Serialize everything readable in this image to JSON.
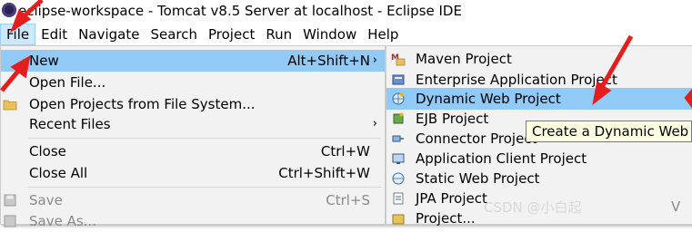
{
  "window": {
    "title": "eclipse-workspace - Tomcat v8.5 Server at localhost - Eclipse IDE"
  },
  "menubar": [
    "File",
    "Edit",
    "Navigate",
    "Search",
    "Project",
    "Run",
    "Window",
    "Help"
  ],
  "file_menu": {
    "new": {
      "label": "New",
      "shortcut": "Alt+Shift+N"
    },
    "open_file": "Open File...",
    "open_projects": "Open Projects from File System...",
    "recent_files": "Recent Files",
    "close": {
      "label": "Close",
      "shortcut": "Ctrl+W"
    },
    "close_all": {
      "label": "Close All",
      "shortcut": "Ctrl+Shift+W"
    },
    "save": {
      "label": "Save",
      "shortcut": "Ctrl+S"
    },
    "save_as": "Save As..."
  },
  "new_submenu": [
    {
      "label": "Maven Project",
      "icon": "maven-project-icon"
    },
    {
      "label": "Enterprise Application Project",
      "icon": "enterprise-app-icon"
    },
    {
      "label": "Dynamic Web Project",
      "icon": "dynamic-web-project-icon"
    },
    {
      "label": "EJB Project",
      "icon": "ejb-project-icon"
    },
    {
      "label": "Connector Project",
      "icon": "connector-project-icon"
    },
    {
      "label": "Application Client Project",
      "icon": "app-client-project-icon"
    },
    {
      "label": "Static Web Project",
      "icon": "static-web-project-icon"
    },
    {
      "label": "JPA Project",
      "icon": "jpa-project-icon"
    },
    {
      "label": "Project...",
      "icon": "project-icon"
    }
  ],
  "tooltip": "Create a Dynamic Web project",
  "watermark": "CSDN @小白起",
  "stray_char": "V"
}
